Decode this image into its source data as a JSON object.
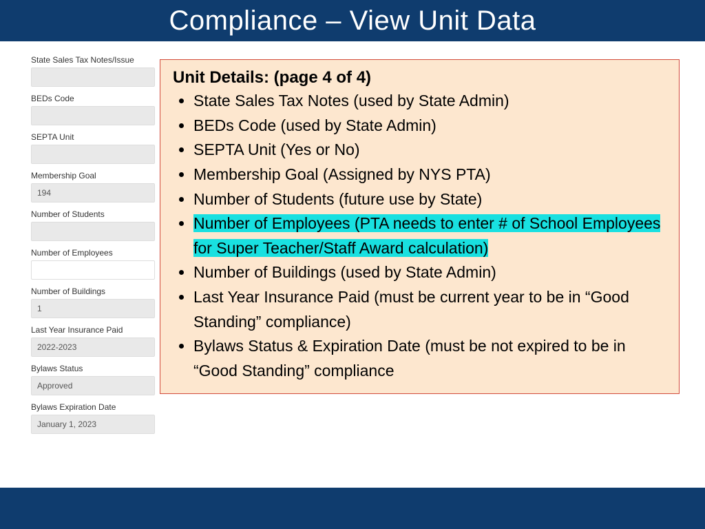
{
  "header": {
    "title": "Compliance – View Unit Data"
  },
  "form": {
    "fields": [
      {
        "label": "State Sales Tax Notes/Issue",
        "value": "",
        "shaded": true
      },
      {
        "label": "BEDs Code",
        "value": "",
        "shaded": true
      },
      {
        "label": "SEPTA Unit",
        "value": "",
        "shaded": true
      },
      {
        "label": "Membership Goal",
        "value": "194",
        "shaded": true
      },
      {
        "label": "Number of Students",
        "value": "",
        "shaded": true
      },
      {
        "label": "Number of Employees",
        "value": "",
        "shaded": false
      },
      {
        "label": "Number of Buildings",
        "value": "1",
        "shaded": true
      },
      {
        "label": "Last Year Insurance Paid",
        "value": "2022-2023",
        "shaded": true
      },
      {
        "label": "Bylaws Status",
        "value": "Approved",
        "shaded": true
      },
      {
        "label": "Bylaws Expiration Date",
        "value": "January 1, 2023",
        "shaded": true
      }
    ]
  },
  "callout": {
    "title": "Unit Details: (page 4 of 4)",
    "items": [
      {
        "text": "State Sales Tax Notes (used by State Admin)"
      },
      {
        "text": "BEDs Code (used by State Admin)"
      },
      {
        "text": "SEPTA Unit (Yes or No)"
      },
      {
        "text": "Membership Goal (Assigned by NYS PTA)"
      },
      {
        "text": "Number of Students (future use by State)"
      },
      {
        "text": "Number of Employees (PTA needs to enter # of School Employees for Super Teacher/Staff Award calculation)",
        "highlight": true
      },
      {
        "text": "Number of Buildings (used by State Admin)"
      },
      {
        "text": "Last Year Insurance Paid (must be current year to be in “Good Standing” compliance)"
      },
      {
        "text": "Bylaws Status & Expiration Date (must be not expired to be in “Good Standing” compliance"
      }
    ]
  }
}
